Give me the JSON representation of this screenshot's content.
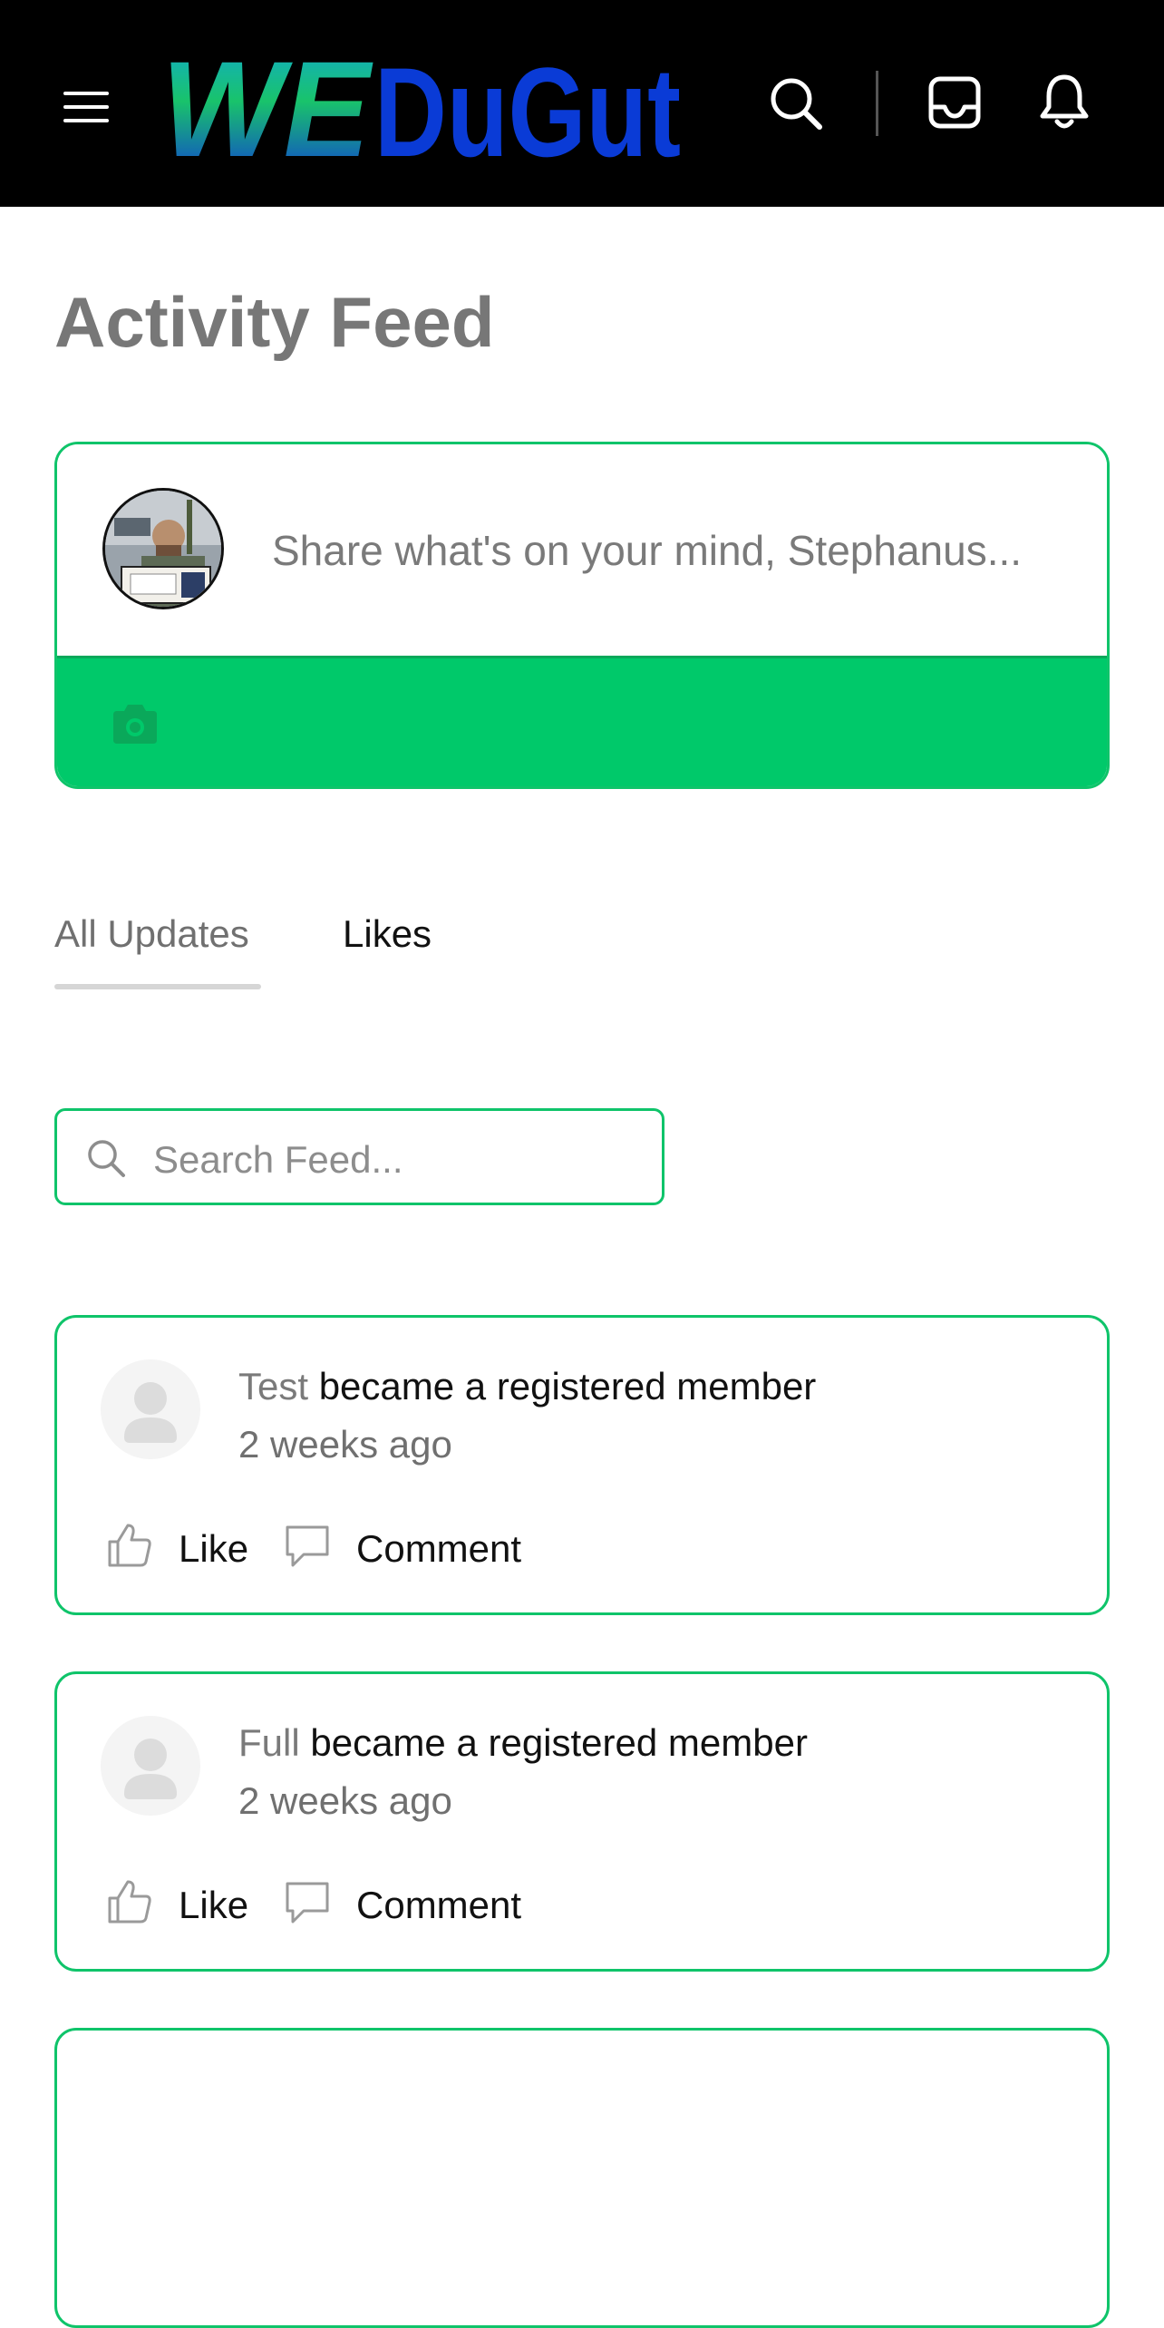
{
  "header": {
    "logo_text": "WEDuGut",
    "icons": [
      "menu-icon",
      "search-icon",
      "inbox-icon",
      "bell-icon"
    ],
    "background": "#000000"
  },
  "page": {
    "title": "Activity Feed"
  },
  "composer": {
    "placeholder": "Share what's on your mind, Stephanus...",
    "action_icon": "camera-icon",
    "accent": "#00c96a"
  },
  "tabs": [
    {
      "label": "All Updates",
      "active": true
    },
    {
      "label": "Likes",
      "active": false
    }
  ],
  "feed_search": {
    "placeholder": "Search Feed..."
  },
  "activities": [
    {
      "user": "Test",
      "action": "became a registered member",
      "time": "2 weeks ago",
      "like_label": "Like",
      "comment_label": "Comment"
    },
    {
      "user": "Full",
      "action": "became a registered member",
      "time": "2 weeks ago",
      "like_label": "Like",
      "comment_label": "Comment"
    }
  ],
  "colors": {
    "accent_green": "#0fc46a",
    "logo_blue": "#0a3bd6"
  }
}
